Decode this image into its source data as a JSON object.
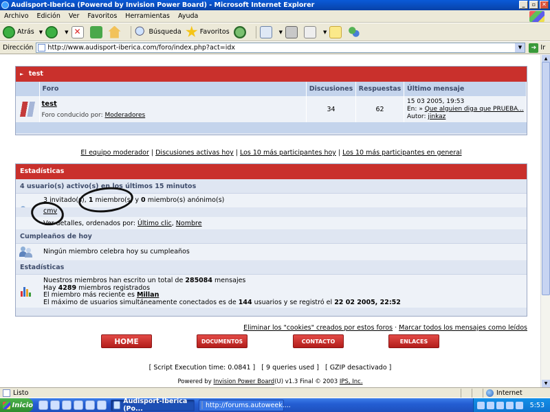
{
  "window": {
    "title": "Audisport-Iberica (Powered by Invision Power Board) - Microsoft Internet Explorer"
  },
  "menu": [
    "Archivo",
    "Edición",
    "Ver",
    "Favoritos",
    "Herramientas",
    "Ayuda"
  ],
  "toolbar": {
    "back": "Atrás",
    "search": "Búsqueda",
    "favorites": "Favoritos"
  },
  "address": {
    "label": "Dirección",
    "url": "http://www.audisport-iberica.com/foro/index.php?act=idx",
    "go": "Ir"
  },
  "category": {
    "title": "test",
    "headers": {
      "forum": "Foro",
      "topics": "Discusiones",
      "replies": "Respuestas",
      "last": "Último mensaje"
    },
    "forum": {
      "name": "test",
      "moderated_by": "Foro conducido por:",
      "moderators": "Moderadores",
      "topics": "34",
      "replies": "62",
      "last_date": "15 03 2005, 19:53",
      "last_in": "En:",
      "last_topic": "Que alguien diga que PRUEBA...",
      "last_author_label": "Autor:",
      "last_author": "jinkaz"
    }
  },
  "mod_links": [
    "El equipo moderador",
    "Discusiones activas hoy",
    "Los 10 más participantes hoy",
    "Los 10 más participantes en general"
  ],
  "stats": {
    "title": "Estadísticas",
    "active_heading": "4 usuario(s) activo(s) en los últimos 15 minutos",
    "guests": "3",
    "guests_label": "invitado(s),",
    "members": "1",
    "members_label": "miembro(s) y",
    "anon": "0",
    "anon_label": "miembro(s) anónimo(s)",
    "active_user": "cmv",
    "details_label": "Ver detalles, ordenados por:",
    "sort_last_click": "Último clic",
    "sort_name": "Nombre",
    "birthday_heading": "Cumpleaños de hoy",
    "birthday_text": "Ningún miembro celebra hoy su cumpleaños",
    "board_heading": "Estadísticas",
    "posts_pre": "Nuestros miembros han escrito un total de",
    "posts_total": "285084",
    "posts_post": "mensajes",
    "members_pre": "Hay",
    "members_total": "4289",
    "members_post": "miembros registrados",
    "newest_pre": "El miembro más reciente es",
    "newest_member": "Millan",
    "record_pre": "El máximo de usuarios simultáneamente conectados es de",
    "record_count": "144",
    "record_mid": "usuarios y se registró el",
    "record_date": "22 02 2005, 22:52"
  },
  "bottom_links": {
    "cookies": "Eliminar los \"cookies\" creados por estos foros",
    "mark_read": "Marcar todos los mensajes como leídos"
  },
  "nav_buttons": [
    "HOME",
    "DOCUMENTOS",
    "CONTACTO",
    "ENLACES"
  ],
  "script_info": "[ Script Execution time: 0.0841 ]   [ 9 queries used ]   [ GZIP desactivado ]",
  "powered": {
    "pre": "Powered by",
    "ipb": "Invision Power Board",
    "mid": "(U) v1.3 Final © 2003",
    "ips": "IPS, Inc."
  },
  "status": {
    "text": "Listo",
    "zone": "Internet"
  },
  "taskbar": {
    "start": "Inicio",
    "tasks": [
      "Audisport-Iberica (Po...",
      "http://forums.autoweek...."
    ],
    "clock": "5:53"
  },
  "colors": {
    "accent_red": "#c9302c",
    "header_blue": "#c4d4ec",
    "row_blue": "#eef2f8"
  }
}
